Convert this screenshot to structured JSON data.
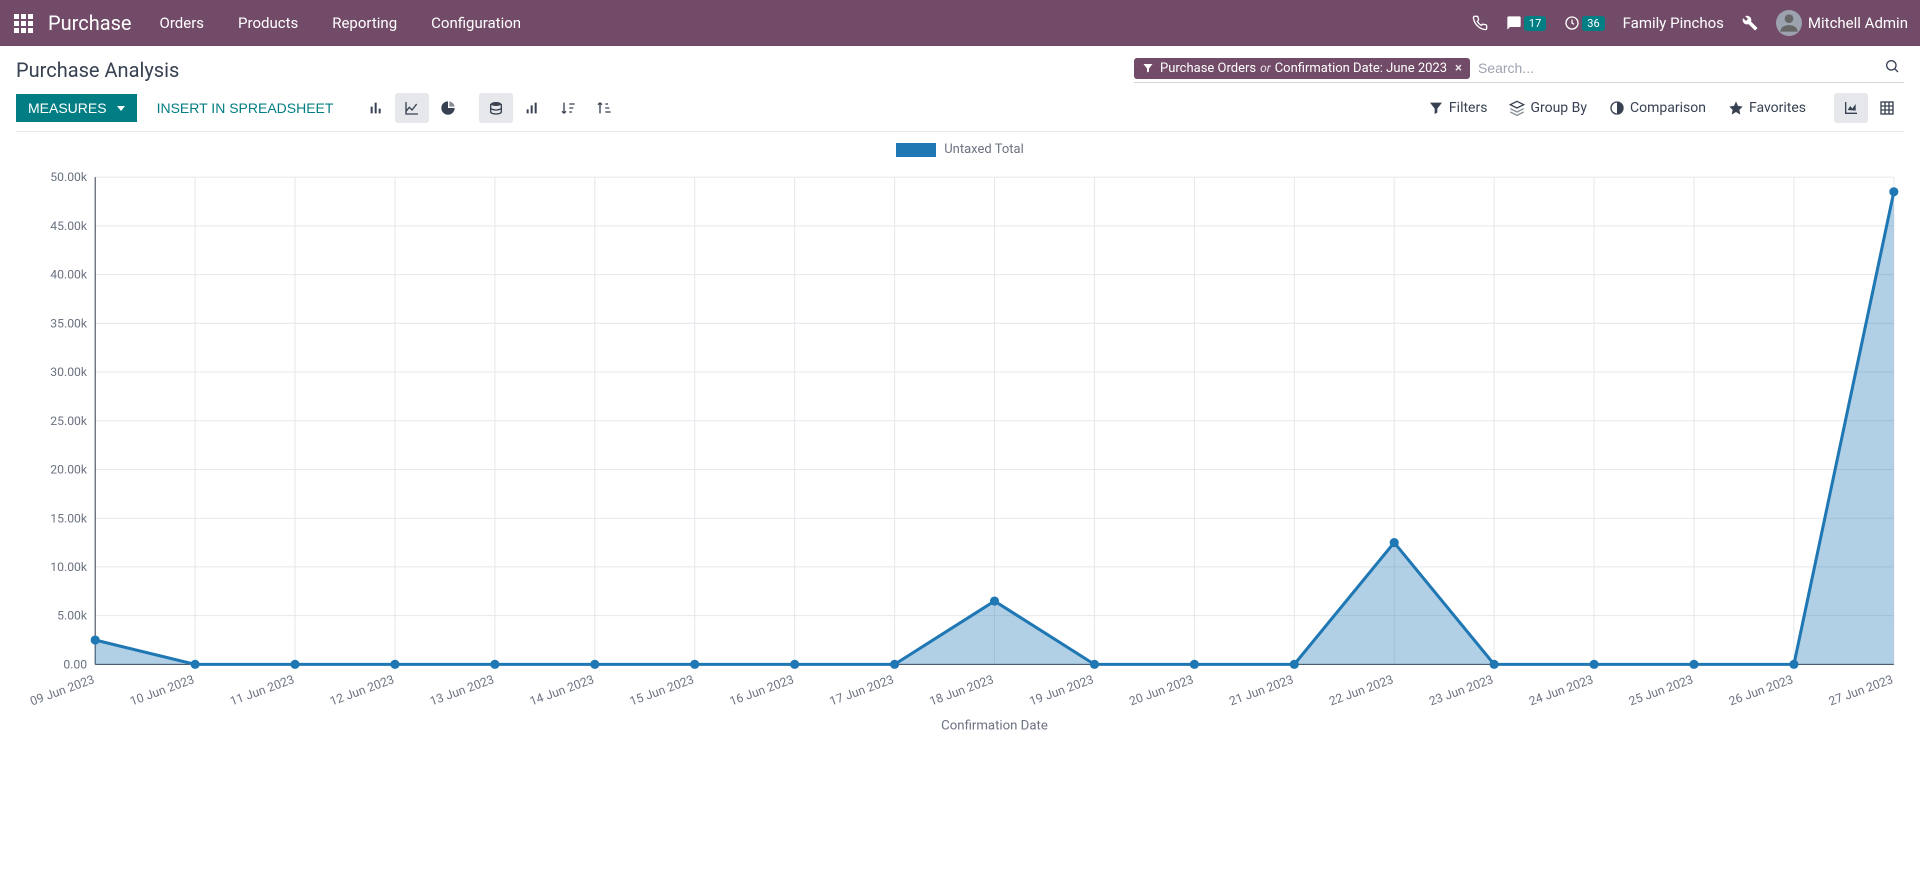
{
  "navbar": {
    "brand": "Purchase",
    "menu": [
      "Orders",
      "Products",
      "Reporting",
      "Configuration"
    ],
    "messages_badge": "17",
    "activities_badge": "36",
    "company": "Family Pinchos",
    "user": "Mitchell Admin"
  },
  "page": {
    "title": "Purchase Analysis",
    "search_placeholder": "Search...",
    "facet_a": "Purchase Orders",
    "facet_or": "or",
    "facet_b": "Confirmation Date: June 2023"
  },
  "buttons": {
    "measures": "Measures",
    "spreadsheet": "Insert in Spreadsheet"
  },
  "search_options": {
    "filters": "Filters",
    "group_by": "Group By",
    "comparison": "Comparison",
    "favorites": "Favorites"
  },
  "chart_legend": "Untaxed Total",
  "chart_data": {
    "type": "area",
    "title": "",
    "xlabel": "Confirmation Date",
    "ylabel": "",
    "ylim": [
      0,
      50000
    ],
    "y_ticks": [
      0,
      5000,
      10000,
      15000,
      20000,
      25000,
      30000,
      35000,
      40000,
      45000,
      50000
    ],
    "y_tick_labels": [
      "0.00",
      "5.00k",
      "10.00k",
      "15.00k",
      "20.00k",
      "25.00k",
      "30.00k",
      "35.00k",
      "40.00k",
      "45.00k",
      "50.00k"
    ],
    "categories": [
      "09 Jun 2023",
      "10 Jun 2023",
      "11 Jun 2023",
      "12 Jun 2023",
      "13 Jun 2023",
      "14 Jun 2023",
      "15 Jun 2023",
      "16 Jun 2023",
      "17 Jun 2023",
      "18 Jun 2023",
      "19 Jun 2023",
      "20 Jun 2023",
      "21 Jun 2023",
      "22 Jun 2023",
      "23 Jun 2023",
      "24 Jun 2023",
      "25 Jun 2023",
      "26 Jun 2023",
      "27 Jun 2023"
    ],
    "series": [
      {
        "name": "Untaxed Total",
        "values": [
          2500,
          0,
          0,
          0,
          0,
          0,
          0,
          0,
          0,
          6500,
          0,
          0,
          0,
          12500,
          0,
          0,
          0,
          0,
          48500
        ]
      }
    ]
  }
}
